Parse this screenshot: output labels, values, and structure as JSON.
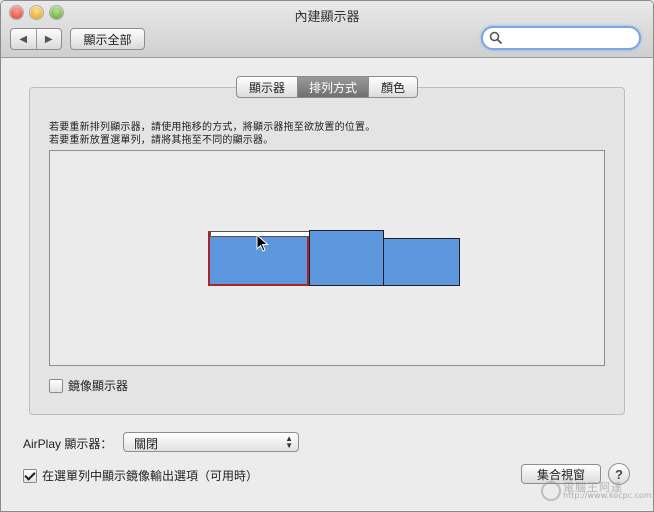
{
  "window": {
    "title": "內建顯示器"
  },
  "toolbar": {
    "back_label": "◀",
    "forward_label": "▶",
    "show_all_label": "顯示全部",
    "search": {
      "placeholder": "",
      "value": ""
    }
  },
  "tabs": [
    {
      "label": "顯示器",
      "selected": false
    },
    {
      "label": "排列方式",
      "selected": true
    },
    {
      "label": "顏色",
      "selected": false
    }
  ],
  "arrangement": {
    "instruction_line1": "若要重新排列顯示器，請使用拖移的方式，將顯示器拖至欲放置的位置。",
    "instruction_line2": "若要重新放置選單列，請將其拖至不同的顯示器。",
    "displays": [
      {
        "id": "display-1",
        "has_menubar": true,
        "selected": true
      },
      {
        "id": "display-2",
        "has_menubar": false,
        "selected": false
      },
      {
        "id": "display-3",
        "has_menubar": false,
        "selected": false
      }
    ]
  },
  "mirror": {
    "label": "鏡像顯示器",
    "checked": false
  },
  "airplay": {
    "label": "AirPlay 顯示器：",
    "value": "關閉"
  },
  "menubar_option": {
    "label": "在選單列中顯示鏡像輸出選項（可用時）",
    "checked": true
  },
  "buttons": {
    "gather_label": "集合視窗",
    "help_label": "?"
  },
  "watermark": {
    "title": "電腦王阿達",
    "url": "http://www.kocpc.com.tw"
  },
  "colors": {
    "display_fill": "#5d97de",
    "selected_border": "#a8262a",
    "focus_ring": "#7aa7e0"
  },
  "icons": {
    "search": "search-icon",
    "cursor": "arrow-cursor-icon",
    "help": "help-icon"
  }
}
